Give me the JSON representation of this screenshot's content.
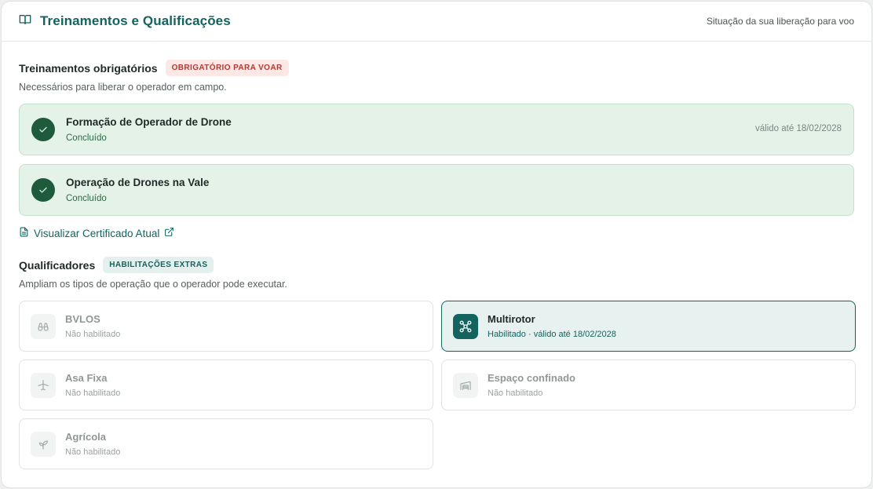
{
  "header": {
    "title": "Treinamentos e Qualificações",
    "subtitle": "Situação da sua liberação para voo",
    "icon": "book-open-icon"
  },
  "mandatory": {
    "title": "Treinamentos obrigatórios",
    "badge": "OBRIGATÓRIO PARA VOAR",
    "description": "Necessários para liberar o operador em campo.",
    "items": [
      {
        "name": "Formação de Operador de Drone",
        "status": "Concluído",
        "valid": "válido até 18/02/2028"
      },
      {
        "name": "Operação de Drones na Vale",
        "status": "Concluído",
        "valid": ""
      }
    ],
    "certificate_link": "Visualizar Certificado Atual"
  },
  "qualifiers": {
    "title": "Qualificadores",
    "badge": "HABILITAÇÕES EXTRAS",
    "description": "Ampliam os tipos de operação que o operador pode executar.",
    "items": [
      {
        "name": "BVLOS",
        "status": "Não habilitado",
        "icon": "binoculars-icon",
        "active": false
      },
      {
        "name": "Multirotor",
        "status": "Habilitado · válido até 18/02/2028",
        "icon": "drone-icon",
        "active": true
      },
      {
        "name": "Asa Fixa",
        "status": "Não habilitado",
        "icon": "plane-icon",
        "active": false
      },
      {
        "name": "Espaço confinado",
        "status": "Não habilitado",
        "icon": "warehouse-icon",
        "active": false
      },
      {
        "name": "Agrícola",
        "status": "Não habilitado",
        "icon": "sprout-icon",
        "active": false
      }
    ]
  },
  "colors": {
    "brand": "#13635f",
    "success_bg": "#e5f2e8",
    "success_dark": "#1f5a3c",
    "danger_text": "#b23a34",
    "danger_bg": "#fde8e6"
  }
}
